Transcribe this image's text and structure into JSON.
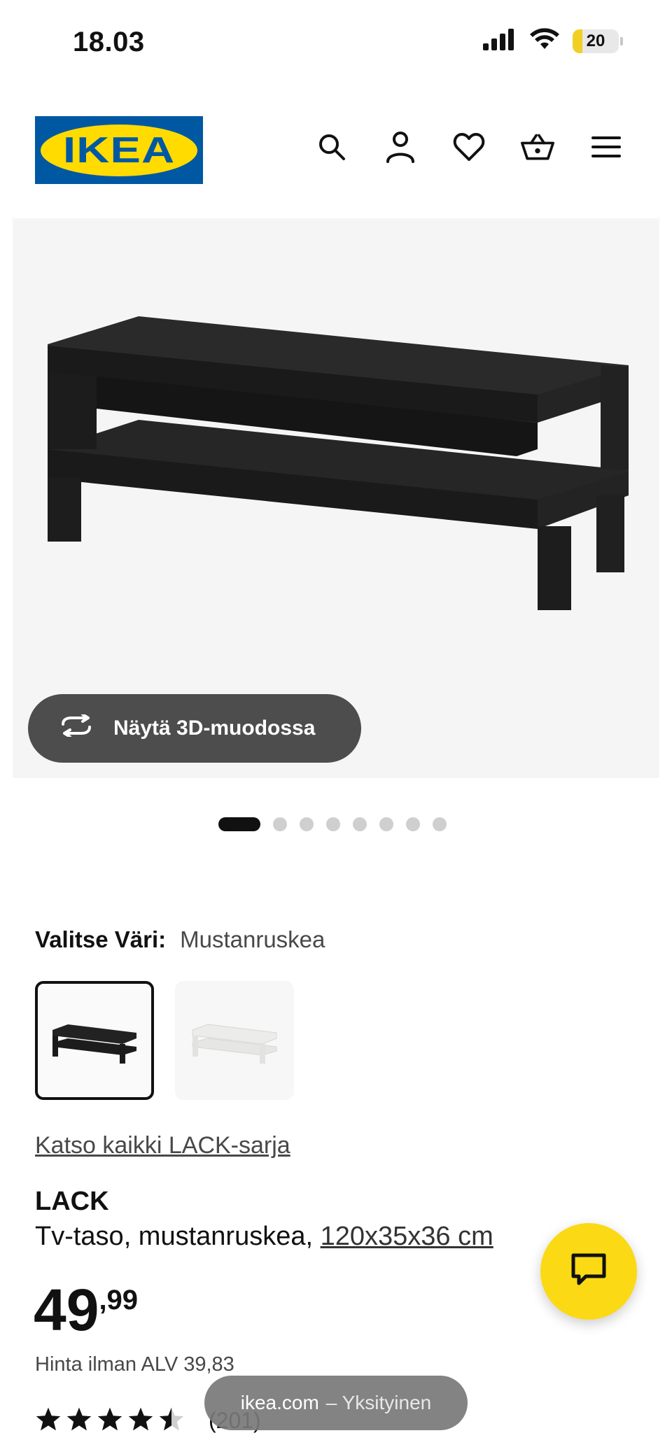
{
  "status_bar": {
    "time": "18.03",
    "battery_level": "20"
  },
  "header": {
    "logo_text": "IKEA",
    "icons": [
      "search-icon",
      "profile-icon",
      "heart-icon",
      "basket-icon",
      "menu-icon"
    ]
  },
  "gallery": {
    "view_3d_label": "Näytä 3D-muodossa",
    "total_images": 8,
    "active_index": 0
  },
  "color_select": {
    "label": "Valitse Väri:",
    "value": "Mustanruskea",
    "swatches": [
      {
        "name": "Mustanruskea",
        "color": "#1e1e1e",
        "selected": true
      },
      {
        "name": "Valkoinen",
        "color": "#f4f4f2",
        "selected": false
      }
    ]
  },
  "series_link": "Katso kaikki LACK-sarja",
  "product": {
    "name": "LACK",
    "description": "Tv-taso, mustanruskea,",
    "dimensions": "120x35x36 cm",
    "price_integer": "49",
    "price_decimal": ",99",
    "vat_line": "Hinta ilman ALV 39,83",
    "rating": 4.5,
    "review_count": "(201)"
  },
  "browser": {
    "domain": "ikea.com",
    "mode": "– Yksityinen"
  },
  "colors": {
    "ikea_blue": "#0058a3",
    "ikea_yellow": "#ffdb00",
    "chat_yellow": "#fbd914"
  }
}
